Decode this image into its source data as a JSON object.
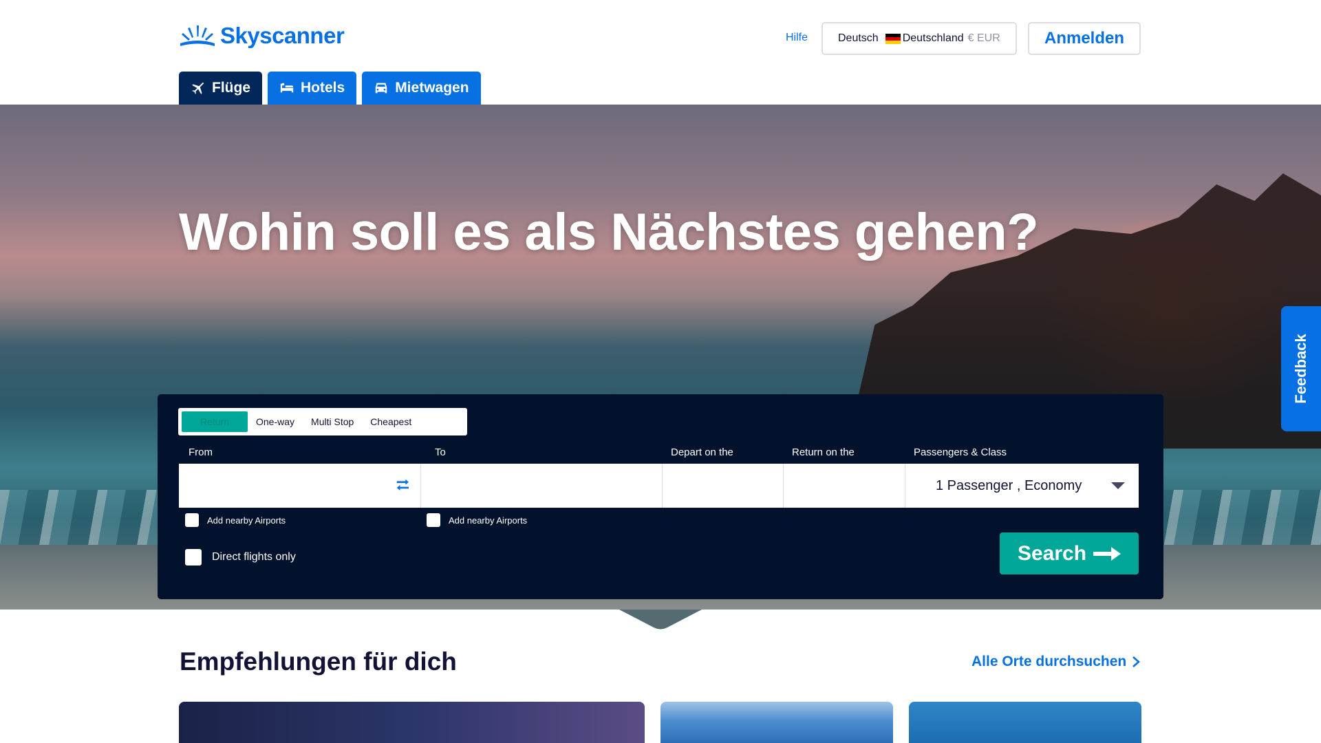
{
  "brand": {
    "name": "Skyscanner",
    "color": "#0770e3"
  },
  "header": {
    "help_label": "Hilfe",
    "locale": {
      "language": "Deutsch",
      "country": "Deutschland",
      "currency": "€ EUR",
      "flag": "germany-flag"
    },
    "login_label": "Anmelden"
  },
  "nav": {
    "tabs": [
      {
        "label": "Flüge",
        "icon": "plane-icon",
        "active": true
      },
      {
        "label": "Hotels",
        "icon": "bed-icon",
        "active": false
      },
      {
        "label": "Mietwagen",
        "icon": "car-icon",
        "active": false
      }
    ]
  },
  "hero": {
    "headline": "Wohin soll es als Nächstes gehen?"
  },
  "search": {
    "trip_types": [
      {
        "label": "Return",
        "active": true
      },
      {
        "label": "One-way",
        "active": false
      },
      {
        "label": "Multi Stop",
        "active": false
      },
      {
        "label": "Cheapest",
        "active": false
      }
    ],
    "labels": {
      "from": "From",
      "to": "To",
      "depart": "Depart on the",
      "return": "Return on the",
      "passengers": "Passengers & Class"
    },
    "values": {
      "from": "",
      "to": "",
      "depart": "",
      "return": ""
    },
    "passengers_value": "1 Passenger , Economy",
    "nearby_label": "Add nearby Airports",
    "direct_label": "Direct flights only",
    "search_label": "Search",
    "accent_color": "#00a698",
    "panel_color": "#02122c"
  },
  "feedback_label": "Feedback",
  "recommendations": {
    "title": "Empfehlungen für dich",
    "link_label": "Alle Orte durchsuchen"
  }
}
